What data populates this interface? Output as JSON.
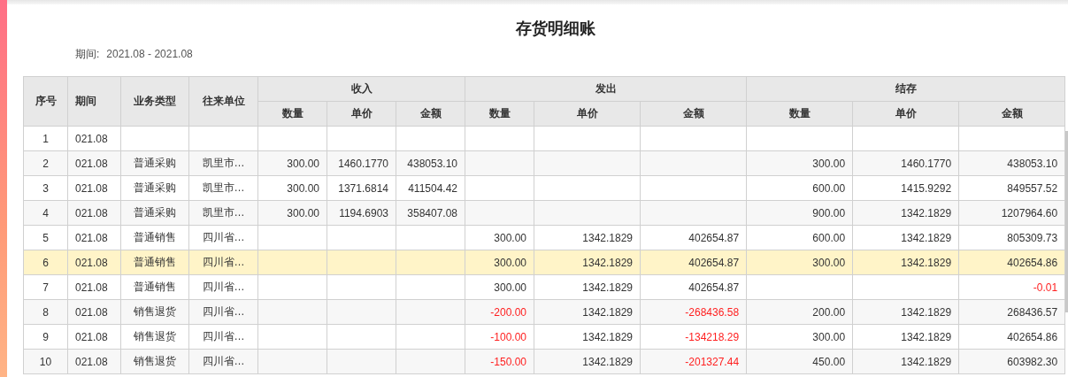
{
  "title": "存货明细账",
  "period": {
    "label": "期间:",
    "value": "2021.08 - 2021.08"
  },
  "table": {
    "columns": [
      {
        "label": "序号"
      },
      {
        "label": "期间"
      },
      {
        "label": "业务类型"
      },
      {
        "label": "往来单位"
      }
    ],
    "groups": [
      {
        "label": "收入",
        "columns": [
          "数量",
          "单价",
          "金额"
        ]
      },
      {
        "label": "发出",
        "columns": [
          "数量",
          "单价",
          "金额"
        ]
      },
      {
        "label": "结存",
        "columns": [
          "数量",
          "单价",
          "金额"
        ]
      }
    ],
    "rows": [
      {
        "selected": false,
        "cells": [
          "1",
          "021.08",
          null,
          null,
          null,
          null,
          null,
          null,
          null,
          null,
          null,
          null,
          null
        ]
      },
      {
        "selected": false,
        "cells": [
          "2",
          "021.08",
          "普通采购",
          "凯里市…",
          "300.00",
          "1460.1770",
          "438053.10",
          null,
          null,
          null,
          "300.00",
          "1460.1770",
          "438053.10"
        ]
      },
      {
        "selected": false,
        "cells": [
          "3",
          "021.08",
          "普通采购",
          "凯里市…",
          "300.00",
          "1371.6814",
          "411504.42",
          null,
          null,
          null,
          "600.00",
          "1415.9292",
          "849557.52"
        ]
      },
      {
        "selected": false,
        "cells": [
          "4",
          "021.08",
          "普通采购",
          "凯里市…",
          "300.00",
          "1194.6903",
          "358407.08",
          null,
          null,
          null,
          "900.00",
          "1342.1829",
          "1207964.60"
        ]
      },
      {
        "selected": false,
        "cells": [
          "5",
          "021.08",
          "普通销售",
          "四川省…",
          null,
          null,
          null,
          "300.00",
          "1342.1829",
          "402654.87",
          "600.00",
          "1342.1829",
          "805309.73"
        ]
      },
      {
        "selected": true,
        "cells": [
          "6",
          "021.08",
          "普通销售",
          "四川省…",
          null,
          null,
          null,
          "300.00",
          "1342.1829",
          "402654.87",
          "300.00",
          "1342.1829",
          "402654.86"
        ]
      },
      {
        "selected": false,
        "cells": [
          "7",
          "021.08",
          "普通销售",
          "四川省…",
          null,
          null,
          null,
          "300.00",
          "1342.1829",
          "402654.87",
          null,
          null,
          {
            "text": "-0.01",
            "negative": true
          }
        ]
      },
      {
        "selected": false,
        "cells": [
          "8",
          "021.08",
          "销售退货",
          "四川省…",
          null,
          null,
          null,
          {
            "text": "-200.00",
            "negative": true
          },
          "1342.1829",
          {
            "text": "-268436.58",
            "negative": true
          },
          "200.00",
          "1342.1829",
          "268436.57"
        ]
      },
      {
        "selected": false,
        "cells": [
          "9",
          "021.08",
          "销售退货",
          "四川省…",
          null,
          null,
          null,
          {
            "text": "-100.00",
            "negative": true
          },
          "1342.1829",
          {
            "text": "-134218.29",
            "negative": true
          },
          "300.00",
          "1342.1829",
          "402654.86"
        ]
      },
      {
        "selected": false,
        "cells": [
          "10",
          "021.08",
          "销售退货",
          "四川省…",
          null,
          null,
          null,
          {
            "text": "-150.00",
            "negative": true
          },
          "1342.1829",
          {
            "text": "-201327.44",
            "negative": true
          },
          "450.00",
          "1342.1829",
          "603982.30"
        ]
      }
    ]
  }
}
